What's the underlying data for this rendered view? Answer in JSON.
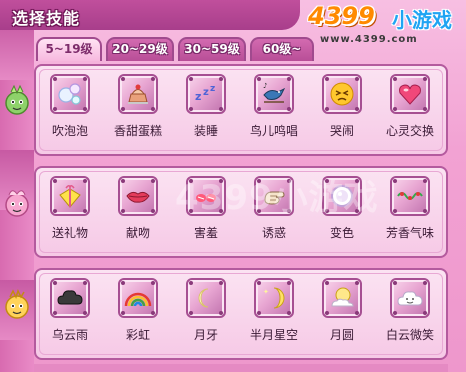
{
  "title": "选择技能",
  "logo": {
    "number": "4399",
    "cn": "小游戏",
    "url": "www.4399.com"
  },
  "watermark": "4399小游戏",
  "tabs": [
    {
      "label": "5~19级",
      "active": true
    },
    {
      "label": "20~29级",
      "active": false
    },
    {
      "label": "30~59级",
      "active": false
    },
    {
      "label": "60级~",
      "active": false
    }
  ],
  "rows": [
    {
      "skills": [
        {
          "label": "吹泡泡",
          "icon": "bubbles-icon"
        },
        {
          "label": "香甜蛋糕",
          "icon": "cake-icon"
        },
        {
          "label": "装睡",
          "icon": "zzz-sleep-icon"
        },
        {
          "label": "鸟儿鸣唱",
          "icon": "bird-icon"
        },
        {
          "label": "哭闹",
          "icon": "crying-face-icon"
        },
        {
          "label": "心灵交换",
          "icon": "heart-icon"
        }
      ]
    },
    {
      "skills": [
        {
          "label": "送礼物",
          "icon": "gift-icon"
        },
        {
          "label": "献吻",
          "icon": "lips-icon"
        },
        {
          "label": "害羞",
          "icon": "blush-icon"
        },
        {
          "label": "诱惑",
          "icon": "hand-icon"
        },
        {
          "label": "变色",
          "icon": "color-change-icon"
        },
        {
          "label": "芳香气味",
          "icon": "fragrance-icon"
        }
      ]
    },
    {
      "skills": [
        {
          "label": "乌云雨",
          "icon": "dark-cloud-icon"
        },
        {
          "label": "彩虹",
          "icon": "rainbow-icon"
        },
        {
          "label": "月牙",
          "icon": "crescent-moon-icon"
        },
        {
          "label": "半月星空",
          "icon": "half-moon-stars-icon"
        },
        {
          "label": "月圆",
          "icon": "full-moon-icon"
        },
        {
          "label": "白云微笑",
          "icon": "smiling-cloud-icon"
        }
      ]
    }
  ],
  "colors": {
    "accent": "#b84e97",
    "panel": "#f6c9e6",
    "logo_orange": "#ff8a00",
    "logo_blue": "#20a4f3"
  }
}
